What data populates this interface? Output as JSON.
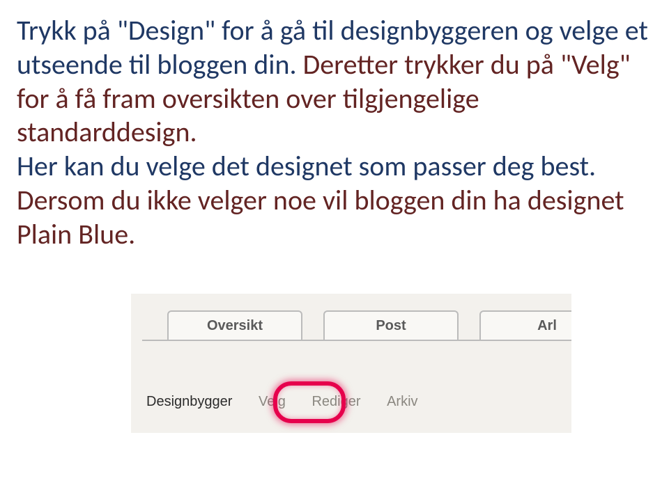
{
  "paragraph": {
    "s1_navy": "Trykk på \"Design\" for å gå til designbyggeren og velge et utseende til bloggen din. ",
    "s2_red": "Deretter trykker du på \"Velg\" for å få fram oversikten over tilgjengelige standarddesign.",
    "s3_navy_a": "Her kan du velge det designet som passer deg best. ",
    "s3_red": "Dersom du ikke velger noe vil bloggen din ha designet Plain Blue."
  },
  "tabs": {
    "t1": "Oversikt",
    "t2": "Post",
    "t3": "Arl"
  },
  "subnav": {
    "i1": "Designbygger",
    "i2": "Velg",
    "i3": "Rediger",
    "i4": "Arkiv"
  }
}
